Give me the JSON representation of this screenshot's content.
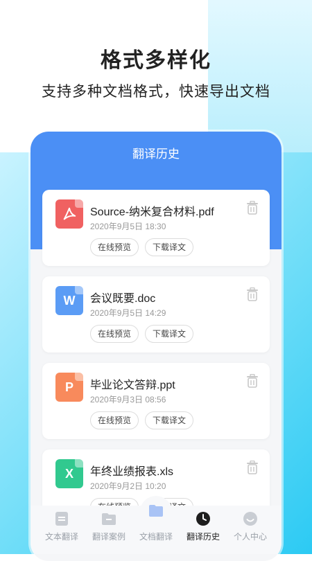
{
  "promo": {
    "headline": "格式多样化",
    "subline": "支持多种文档格式，快速导出文档"
  },
  "screen": {
    "title": "翻译历史",
    "items": [
      {
        "name": "Source-纳米复合材料.pdf",
        "date": "2020年9月5日 18:30",
        "icon_letter": "",
        "icon_name": "pdf-icon",
        "color": "#f06161"
      },
      {
        "name": "会议既要.doc",
        "date": "2020年9月5日 14:29",
        "icon_letter": "W",
        "icon_name": "word-doc-icon",
        "color": "#5b9cf5"
      },
      {
        "name": "毕业论文答辩.ppt",
        "date": "2020年9月3日 08:56",
        "icon_letter": "P",
        "icon_name": "ppt-icon",
        "color": "#f88a5c"
      },
      {
        "name": "年终业绩报表.xls",
        "date": "2020年9月2日 10:20",
        "icon_letter": "X",
        "icon_name": "excel-icon",
        "color": "#31c98f"
      }
    ],
    "preview_label": "在线预览",
    "download_label": "下载译文"
  },
  "tabbar": {
    "tabs": [
      {
        "label": "文本翻译",
        "icon": "text-doc-icon"
      },
      {
        "label": "翻译案例",
        "icon": "folder-icon"
      },
      {
        "label": "文档翻译",
        "icon": "document-folder-icon"
      },
      {
        "label": "翻译历史",
        "icon": "clock-icon",
        "active": true
      },
      {
        "label": "个人中心",
        "icon": "smiley-icon"
      }
    ]
  },
  "colors": {
    "header_blue": "#4b8ff5",
    "accent_cyan": "#3fd0f5"
  }
}
